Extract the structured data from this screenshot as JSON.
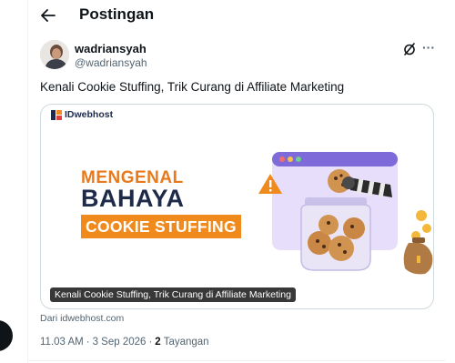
{
  "header": {
    "back_icon": "arrow-left-icon",
    "title": "Postingan"
  },
  "tweet": {
    "author": {
      "display_name": "wadriansyah",
      "handle": "@wadriansyah"
    },
    "actions": {
      "grok_icon": "grok-slash-circle-icon",
      "more_label": "···"
    },
    "text": "Kenali Cookie Stuffing, Trik Curang di Affiliate Marketing",
    "card": {
      "brand": "IDwebhost",
      "headline_line1": "MENGENAL",
      "headline_line2": "BAHAYA",
      "headline_line3": "COOKIE STUFFING",
      "caption": "Kenali Cookie Stuffing, Trik Curang di Affiliate Marketing",
      "source": "Dari idwebhost.com"
    },
    "meta": {
      "time": "11.03 AM",
      "separator": "·",
      "date": "3 Sep 2026",
      "views_count": "2",
      "views_label": "Tayangan"
    }
  },
  "colors": {
    "text_primary": "#0f1419",
    "text_secondary": "#536471",
    "border": "#cfd9de",
    "brand_orange": "#f08a1c",
    "brand_navy": "#1e2a4a"
  }
}
